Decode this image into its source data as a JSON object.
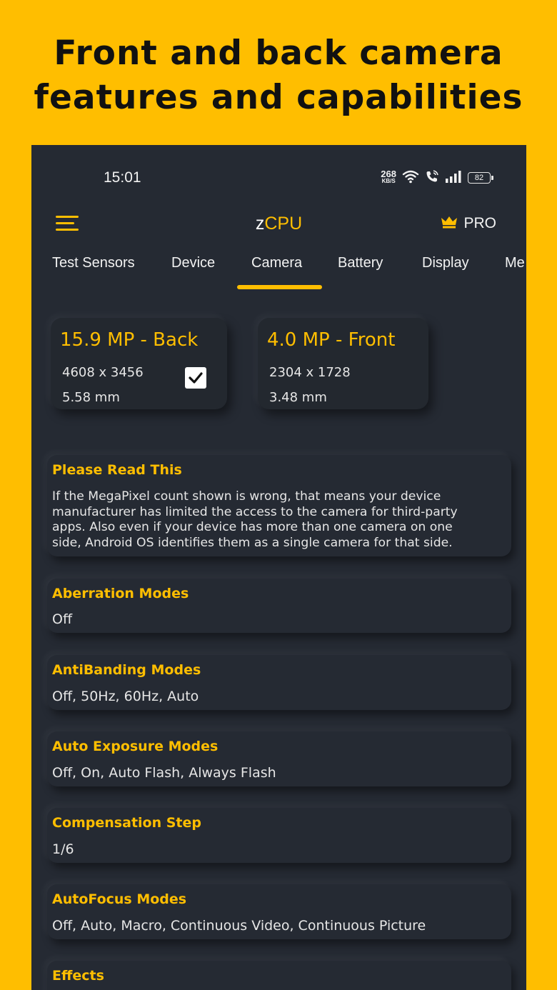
{
  "promo": {
    "headline_line1": "Front and back camera",
    "headline_line2": "features and capabilities"
  },
  "status_bar": {
    "time": "15:01",
    "net_speed": "268",
    "net_speed_unit": "KB/S",
    "battery": "82"
  },
  "app_bar": {
    "title_prefix": "z",
    "title_main": "CPU",
    "pro_label": "PRO"
  },
  "tabs": [
    {
      "label": "Test Sensors",
      "active": false
    },
    {
      "label": "Device",
      "active": false
    },
    {
      "label": "Camera",
      "active": true
    },
    {
      "label": "Battery",
      "active": false
    },
    {
      "label": "Display",
      "active": false
    },
    {
      "label": "Me",
      "active": false
    }
  ],
  "cameras": [
    {
      "title": "15.9 MP - Back",
      "resolution": "4608 x 3456",
      "focal": "5.58 mm",
      "selected": true
    },
    {
      "title": "4.0 MP - Front",
      "resolution": "2304 x 1728",
      "focal": "3.48 mm",
      "selected": false
    }
  ],
  "notice": {
    "title": "Please Read This",
    "lines": [
      "If the MegaPixel count shown is wrong, that means your device",
      "manufacturer has limited the access to the camera for third-party",
      "apps. Also even if your device has more than one camera on one",
      "side, Android OS identifies them as a single camera for that side."
    ]
  },
  "features": [
    {
      "title": "Aberration Modes",
      "value": "Off"
    },
    {
      "title": "AntiBanding Modes",
      "value": "Off, 50Hz, 60Hz, Auto"
    },
    {
      "title": "Auto Exposure Modes",
      "value": "Off, On, Auto Flash, Always Flash"
    },
    {
      "title": "Compensation Step",
      "value": "1/6"
    },
    {
      "title": "AutoFocus Modes",
      "value": "Off, Auto, Macro, Continuous Video, Continuous Picture"
    },
    {
      "title": "Effects",
      "value": ""
    }
  ],
  "colors": {
    "accent": "#FFBE00",
    "background": "#252A33",
    "text": "#E6E6E6"
  },
  "icons": [
    "menu-icon",
    "crown-icon",
    "wifi-icon",
    "call-icon",
    "signal-icon",
    "battery-icon",
    "checkmark-icon"
  ]
}
